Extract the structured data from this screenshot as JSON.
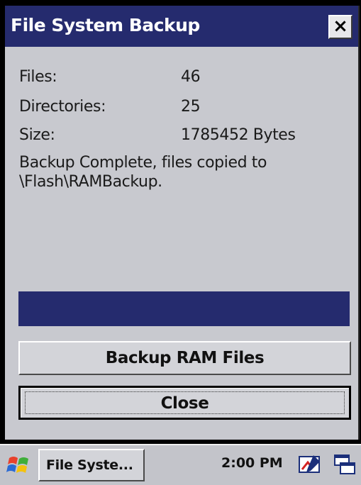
{
  "window": {
    "title": "File System Backup",
    "close_glyph": "×",
    "close_icon": "close-icon"
  },
  "info": {
    "files_label": "Files:",
    "files_value": "46",
    "directories_label": "Directories:",
    "directories_value": "25",
    "size_label": "Size:",
    "size_value": "1785452 Bytes",
    "status_message": "Backup Complete, files copied to \\Flash\\RAMBackup."
  },
  "progress": {
    "fraction": 1.0,
    "color": "#252b6e"
  },
  "buttons": {
    "backup_label": "Backup RAM Files",
    "close_label": "Close"
  },
  "taskbar": {
    "start_icon": "windows-flag-icon",
    "task_label": "File Syste...",
    "clock": "2:00 PM",
    "tray_icons": [
      "pen-input-icon",
      "windows-switcher-icon"
    ]
  },
  "colors": {
    "titlebar": "#252b6e",
    "window_bg": "#c8c9cf",
    "taskbar_bg": "#c3c4ca"
  }
}
